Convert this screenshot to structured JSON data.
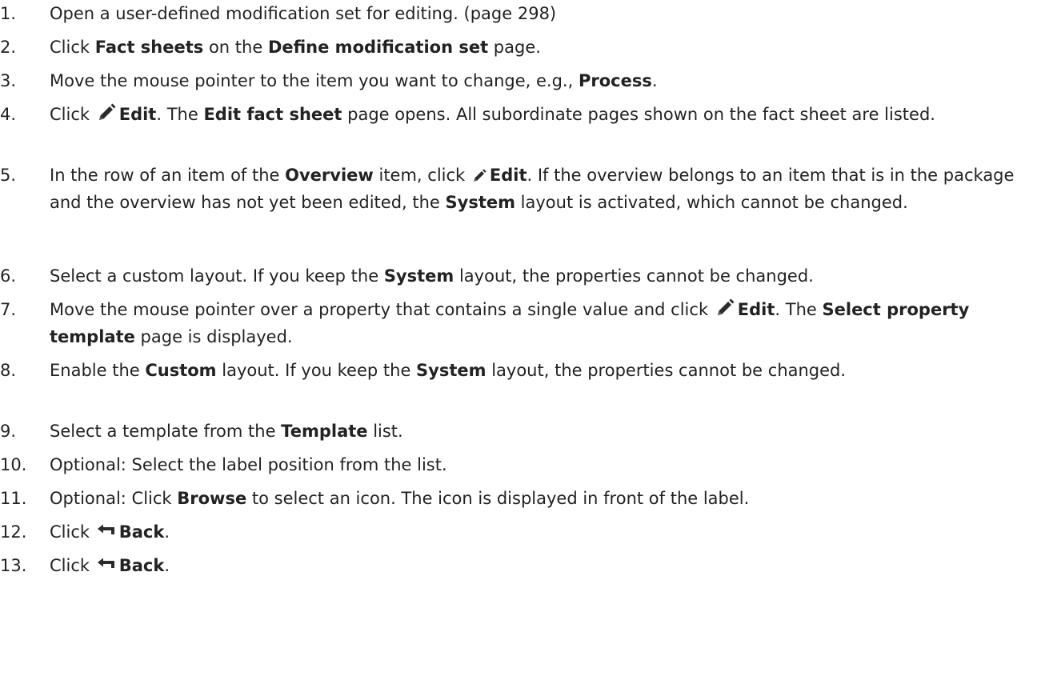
{
  "steps": [
    {
      "num": "1.",
      "parts": [
        {
          "t": "Open a user-defined modification set for editing. (page 298)"
        }
      ]
    },
    {
      "num": "2.",
      "parts": [
        {
          "t": "Click "
        },
        {
          "t": "Fact sheets",
          "b": true
        },
        {
          "t": " on the "
        },
        {
          "t": "Define modification set",
          "b": true
        },
        {
          "t": " page."
        }
      ]
    },
    {
      "num": "3.",
      "parts": [
        {
          "t": "Move the mouse pointer to the item you want to change, e.g., "
        },
        {
          "t": "Process",
          "b": true
        },
        {
          "t": "."
        }
      ]
    },
    {
      "num": "4.",
      "parts": [
        {
          "t": "Click "
        },
        {
          "icon": "pencil-icon",
          "size": "big"
        },
        {
          "t": "Edit",
          "b": true
        },
        {
          "t": ". The "
        },
        {
          "t": "Edit fact sheet",
          "b": true
        },
        {
          "t": " page opens. All subordinate pages shown on the fact sheet are listed."
        }
      ]
    },
    {
      "num": "5.",
      "parts": [
        {
          "t": "In the row of an item of the "
        },
        {
          "t": "Overview",
          "b": true
        },
        {
          "t": " item, click "
        },
        {
          "icon": "pencil-icon",
          "size": "small"
        },
        {
          "t": "Edit",
          "b": true
        },
        {
          "t": ". If the overview belongs to an item that is in the package and the overview has not yet been edited, the "
        },
        {
          "t": "System",
          "b": true
        },
        {
          "t": " layout is activated, which cannot be changed."
        }
      ]
    },
    {
      "num": "6.",
      "parts": [
        {
          "t": "Select a custom layout. If you keep the "
        },
        {
          "t": "System",
          "b": true
        },
        {
          "t": " layout, the properties cannot be changed."
        }
      ]
    },
    {
      "num": "7.",
      "parts": [
        {
          "t": "Move the mouse pointer over a property that contains a single value and click "
        },
        {
          "icon": "pencil-icon",
          "size": "big"
        },
        {
          "t": "Edit",
          "b": true
        },
        {
          "t": ". The "
        },
        {
          "t": "Select property template",
          "b": true
        },
        {
          "t": " page is displayed."
        }
      ]
    },
    {
      "num": "8.",
      "parts": [
        {
          "t": "Enable the "
        },
        {
          "t": "Custom",
          "b": true
        },
        {
          "t": " layout. If you keep the "
        },
        {
          "t": "System",
          "b": true
        },
        {
          "t": " layout, the properties cannot be changed."
        }
      ]
    },
    {
      "num": "9.",
      "parts": [
        {
          "t": "Select a template from the "
        },
        {
          "t": "Template",
          "b": true
        },
        {
          "t": " list."
        }
      ]
    },
    {
      "num": "10.",
      "parts": [
        {
          "t": "Optional: Select the label position from the list."
        }
      ]
    },
    {
      "num": "11.",
      "parts": [
        {
          "t": "Optional: Click "
        },
        {
          "t": "Browse",
          "b": true
        },
        {
          "t": " to select an icon. The icon is displayed in front of the label."
        }
      ]
    },
    {
      "num": "12.",
      "parts": [
        {
          "t": "Click "
        },
        {
          "icon": "back-arrow-icon"
        },
        {
          "t": "Back",
          "b": true
        },
        {
          "t": "."
        }
      ]
    },
    {
      "num": "13.",
      "parts": [
        {
          "t": "Click "
        },
        {
          "icon": "back-arrow-icon"
        },
        {
          "t": "Back",
          "b": true
        },
        {
          "t": "."
        }
      ]
    }
  ],
  "colors": {
    "text": "#222222",
    "icon": "#2b2b2b"
  }
}
